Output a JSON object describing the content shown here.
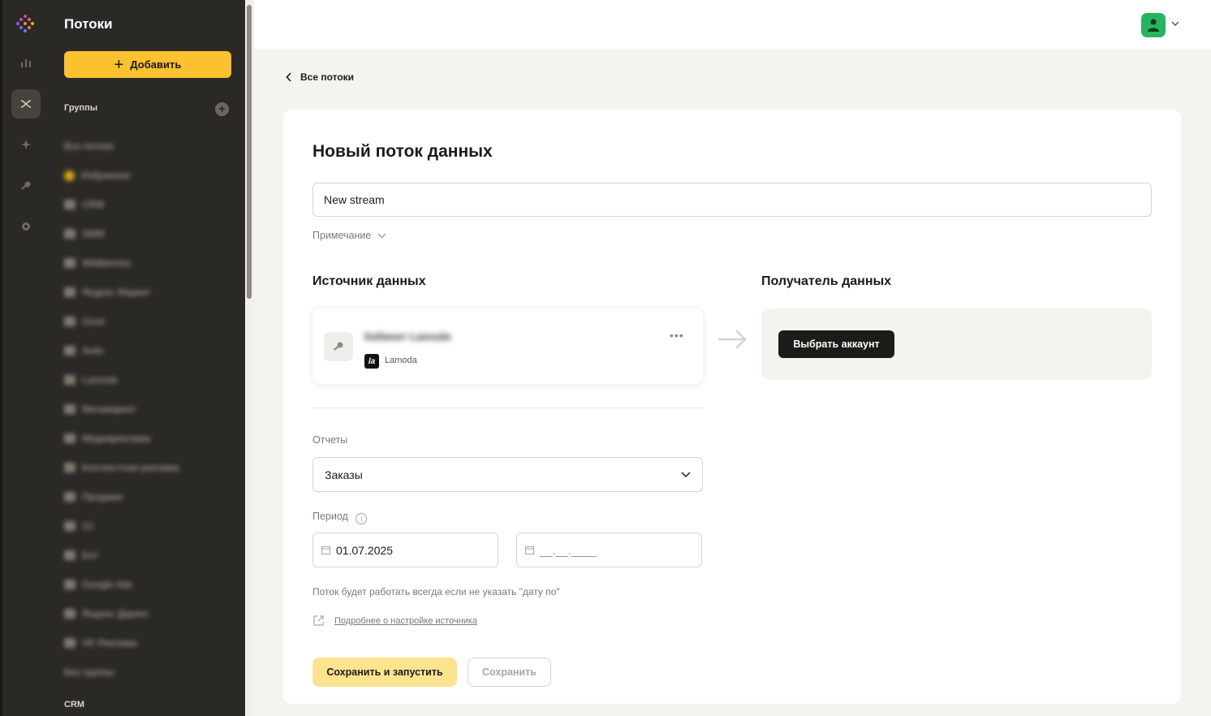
{
  "sidebar": {
    "title": "Потоки",
    "add_label": "Добавить",
    "groups_label": "Группы",
    "groups": [
      {
        "label": "Все потоки",
        "icon": "none"
      },
      {
        "label": "Избранное",
        "icon": "star-icon"
      },
      {
        "label": "CRM",
        "icon": "folder-icon"
      },
      {
        "label": "SMM",
        "icon": "folder-icon"
      },
      {
        "label": "Wildberries",
        "icon": "folder-icon"
      },
      {
        "label": "Яндекс Маркет",
        "icon": "folder-icon"
      },
      {
        "label": "Ozon",
        "icon": "folder-icon"
      },
      {
        "label": "Avito",
        "icon": "folder-icon"
      },
      {
        "label": "Lamoda",
        "icon": "folder-icon"
      },
      {
        "label": "Мегамаркет",
        "icon": "folder-icon"
      },
      {
        "label": "Медиареклама",
        "icon": "folder-icon"
      },
      {
        "label": "Контекстная реклама",
        "icon": "folder-icon"
      },
      {
        "label": "Продажи",
        "icon": "folder-icon"
      },
      {
        "label": "1С",
        "icon": "folder-icon"
      },
      {
        "label": "Бот",
        "icon": "folder-icon"
      },
      {
        "label": "Google Ads",
        "icon": "folder-icon"
      },
      {
        "label": "Яндекс Директ",
        "icon": "folder-icon"
      },
      {
        "label": "VK Реклама",
        "icon": "folder-icon"
      },
      {
        "label": "Без группы",
        "icon": "none"
      }
    ],
    "crm_label": "CRM"
  },
  "breadcrumb": {
    "back_label": "Все потоки"
  },
  "form": {
    "title": "Новый поток данных",
    "name_value": "New stream",
    "note_label": "Примечание",
    "source_title": "Источник данных",
    "destination_title": "Получатель данных",
    "source": {
      "account_name": "Кабинет Lamoda",
      "platform": "Lamoda",
      "logo_text": "la"
    },
    "destination_button": "Выбрать аккаунт",
    "reports_label": "Отчеты",
    "reports_value": "Заказы",
    "period_label": "Период",
    "date_from": "01.07.2025",
    "date_to_placeholder": "__.__.____",
    "hint": "Поток будет работать всегда если не указать \"дату по\"",
    "docs_link": "Подробнее о настройке источника",
    "save_run_label": "Сохранить и запустить",
    "save_label": "Сохранить"
  },
  "colors": {
    "accent": "#fbc12e",
    "sidebar_bg": "#2b2925",
    "avatar": "#27b45e"
  }
}
